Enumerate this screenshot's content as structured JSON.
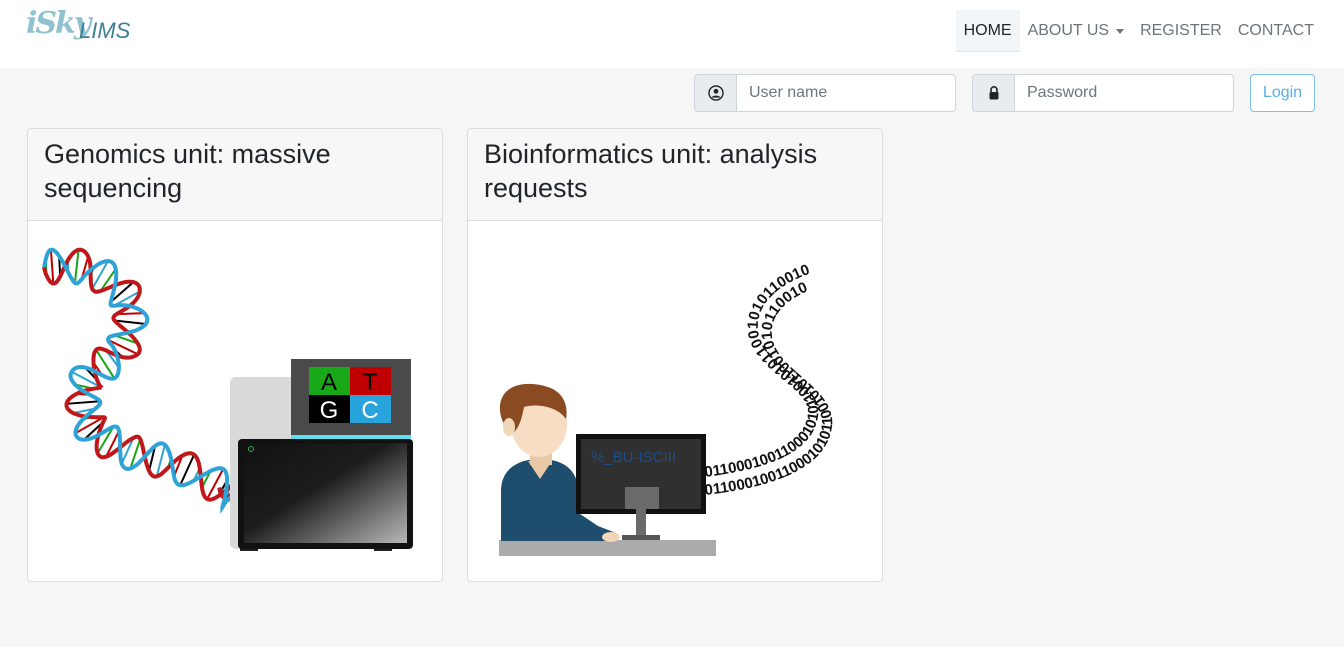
{
  "brand": {
    "logo_prefix": "iSky",
    "logo_suffix": "LIMS"
  },
  "nav": {
    "items": [
      {
        "label": "HOME",
        "active": true
      },
      {
        "label": "ABOUT US",
        "dropdown": true
      },
      {
        "label": "REGISTER"
      },
      {
        "label": "CONTACT"
      }
    ]
  },
  "login": {
    "username_placeholder": "User name",
    "username_value": "",
    "password_placeholder": "Password",
    "password_value": "",
    "button_label": "Login"
  },
  "cards": [
    {
      "title": "Genomics unit: massive sequencing",
      "screen_letters": [
        "A",
        "T",
        "G",
        "C"
      ]
    },
    {
      "title": "Bioinformatics unit: analysis requests",
      "screen_text": "%_BU-ISCIII",
      "binary_text": "0110001001100010101100101011001010110010"
    }
  ],
  "colors": {
    "navbar_bg": "#ffffff",
    "page_bg": "#f6f6f6",
    "brand_light": "#8fc1cf",
    "brand_dark": "#3c7f96",
    "login_btn": "#5aaee0",
    "dna_red": "#c0171a",
    "dna_blue": "#2fa3d6",
    "base_green": "#17a417",
    "base_red": "#c00000",
    "base_blue": "#29a3dc"
  },
  "icons": [
    "user-circle-icon",
    "lock-icon",
    "chevron-down-icon",
    "dna-helix-illustration",
    "sequencer-illustration",
    "scientist-at-computer-illustration"
  ]
}
